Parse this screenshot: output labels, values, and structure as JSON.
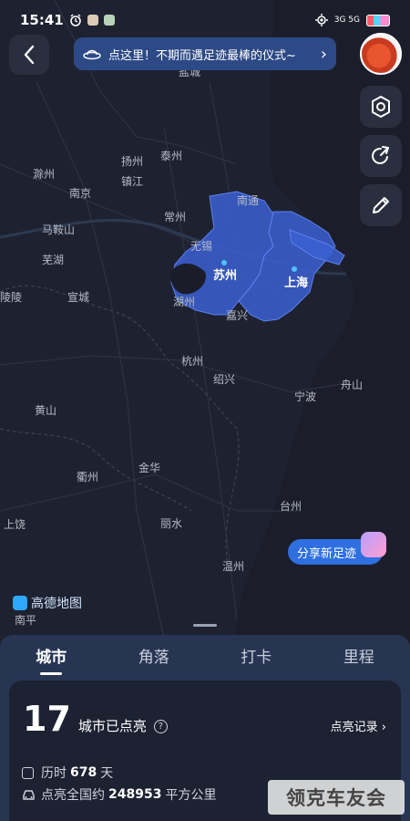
{
  "status": {
    "time": "15:41",
    "net": "3G 5G"
  },
  "banner": {
    "text": "点这里！不期而遇足迹最棒的仪式~",
    "chevron": "›"
  },
  "map": {
    "cities": [
      {
        "name": "盐城"
      },
      {
        "name": "扬州"
      },
      {
        "name": "泰州"
      },
      {
        "name": "滁州"
      },
      {
        "name": "镇江"
      },
      {
        "name": "南京"
      },
      {
        "name": "南通"
      },
      {
        "name": "常州"
      },
      {
        "name": "马鞍山"
      },
      {
        "name": "无锡"
      },
      {
        "name": "芜湖"
      },
      {
        "name": "湖州"
      },
      {
        "name": "宣城"
      },
      {
        "name": "陵陵"
      },
      {
        "name": "嘉兴"
      },
      {
        "name": "杭州"
      },
      {
        "name": "绍兴"
      },
      {
        "name": "舟山"
      },
      {
        "name": "宁波"
      },
      {
        "name": "黄山"
      },
      {
        "name": "衢州"
      },
      {
        "name": "金华"
      },
      {
        "name": "台州"
      },
      {
        "name": "上饶"
      },
      {
        "name": "丽水"
      },
      {
        "name": "温州"
      },
      {
        "name": "南平"
      }
    ],
    "lit_cities": [
      {
        "name": "苏州"
      },
      {
        "name": "上海"
      }
    ],
    "logo_text": "高德地图"
  },
  "share_button": "分享新足迹",
  "tabs": [
    "城市",
    "角落",
    "打卡",
    "里程"
  ],
  "stats": {
    "count": "17",
    "count_label": "城市已点亮",
    "record_link": "点亮记录 ›",
    "duration_prefix": "历时",
    "duration_value": "678",
    "duration_unit": "天",
    "area_prefix": "点亮全国约",
    "area_value": "248953",
    "area_unit": "平方公里"
  },
  "watermark": "领克车友会"
}
